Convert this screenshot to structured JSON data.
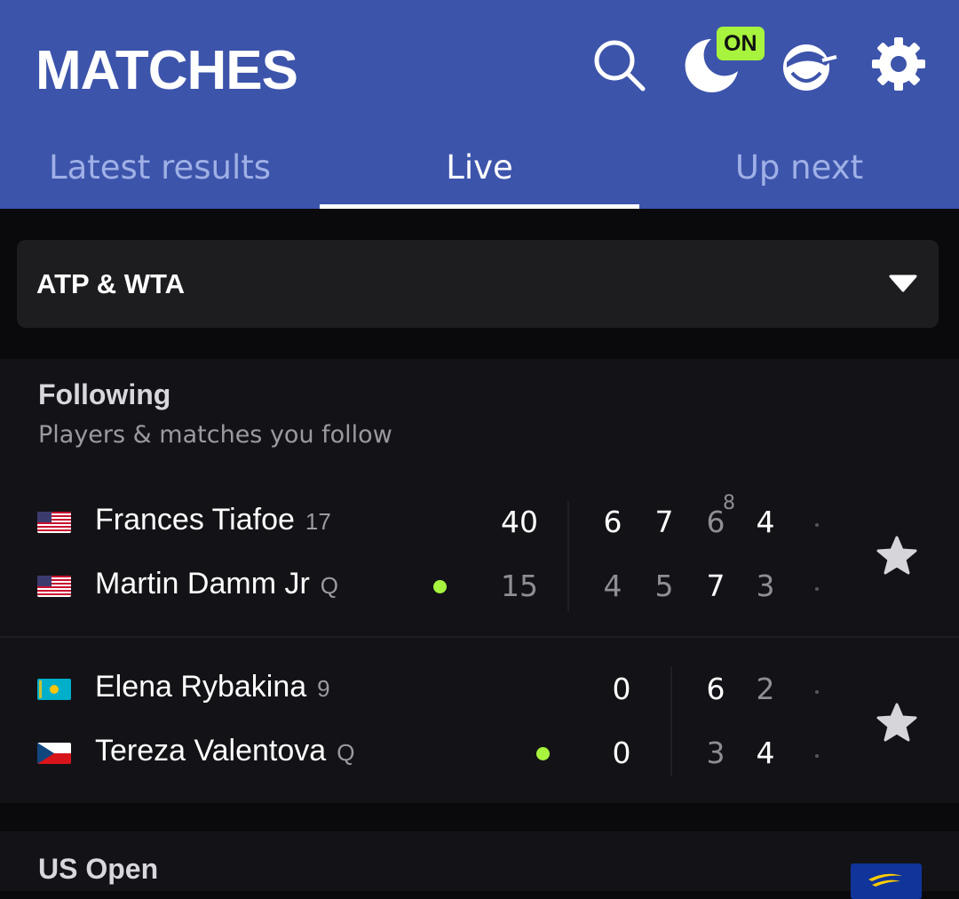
{
  "header": {
    "title": "MATCHES",
    "on_badge": "ON",
    "icons": [
      "search-icon",
      "dark-mode-icon",
      "profile-icon",
      "gear-icon"
    ],
    "tabs": [
      {
        "label": "Latest results",
        "active": false
      },
      {
        "label": "Live",
        "active": true
      },
      {
        "label": "Up next",
        "active": false
      }
    ]
  },
  "filter": {
    "selected": "ATP & WTA"
  },
  "following": {
    "title": "Following",
    "subtitle": "Players & matches you follow",
    "matches": [
      {
        "players": [
          {
            "name": "Frances Tiafoe",
            "seed": "17",
            "flag": "USA",
            "serving": false,
            "point": "40",
            "sets": [
              "6",
              "7",
              "6",
              "4"
            ],
            "tiebreak": "8"
          },
          {
            "name": "Martin Damm Jr",
            "seed": "Q",
            "flag": "USA",
            "serving": true,
            "point": "15",
            "sets": [
              "4",
              "5",
              "7",
              "3"
            ]
          }
        ]
      },
      {
        "players": [
          {
            "name": "Elena Rybakina",
            "seed": "9",
            "flag": "Kazakhstan",
            "serving": false,
            "point": "0",
            "sets": [
              "6",
              "2"
            ]
          },
          {
            "name": "Tereza Valentova",
            "seed": "Q",
            "flag": "Czech Republic",
            "serving": true,
            "point": "0",
            "sets": [
              "3",
              "4"
            ]
          }
        ]
      }
    ]
  },
  "us_open": {
    "title": "US Open"
  },
  "colors": {
    "header_bg": "#3d54ab",
    "accent": "#a7f33d",
    "background": "#0a0a0c",
    "card": "#131317"
  }
}
